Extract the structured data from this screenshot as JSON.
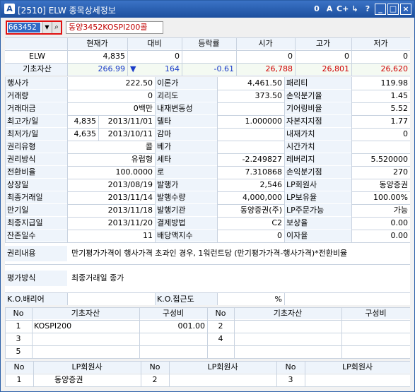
{
  "window": {
    "title": "[2510] ELW 종목상세정보",
    "app_letter": "A",
    "buttons": [
      "0",
      "A",
      "C+",
      "↳",
      "?",
      "_",
      "□",
      "×"
    ]
  },
  "search": {
    "code": "663452",
    "name": "동양3452KOSPI200콜"
  },
  "price_table": {
    "headers": [
      "현재가",
      "대비",
      "등락률",
      "시가",
      "고가",
      "저가"
    ],
    "rows": [
      {
        "label": "ELW",
        "values": [
          "4,835",
          "0",
          "",
          "0",
          "0",
          "0"
        ]
      },
      {
        "label": "기초자산",
        "values": [
          "266.99",
          "164",
          "-0.61",
          "26,788",
          "26,801",
          "26,620"
        ],
        "arrow": "▼"
      }
    ]
  },
  "details": [
    [
      "행사가",
      "222.50",
      "이론가",
      "4,461.50",
      "패리티",
      "119.98"
    ],
    [
      "거래량",
      "0",
      "괴리도",
      "373.50",
      "손익분기율",
      "1.45"
    ],
    [
      "거래대금",
      "0백만",
      "내재변동성",
      "",
      "기어링비율",
      "5.52"
    ],
    [
      "최고가/일",
      "4,835|2013/11/01",
      "델타",
      "1.000000",
      "자본지지점",
      "1.77"
    ],
    [
      "최저가/일",
      "4,635|2013/10/11",
      "감마",
      "",
      "내재가치",
      "0"
    ],
    [
      "권리유형",
      "콜",
      "베가",
      "",
      "시간가치",
      ""
    ],
    [
      "권리방식",
      "유럽형",
      "세타",
      "-2.249827",
      "레버리지",
      "5.520000"
    ],
    [
      "전환비율",
      "100.0000",
      "로",
      "7.310868",
      "손익분기점",
      "270"
    ],
    [
      "상장일",
      "2013/08/19",
      "발행가",
      "2,546",
      "LP회원사",
      "동양증권"
    ],
    [
      "최종거래일",
      "2013/11/14",
      "발행수량",
      "4,000,000",
      "LP보유율",
      "100.00%"
    ],
    [
      "만기일",
      "2013/11/18",
      "발행기관",
      "동양증권(주)",
      "LP주문가능",
      "가능"
    ],
    [
      "최종지급일",
      "2013/11/20",
      "결제방법",
      "C2",
      "보상율",
      "0.00"
    ],
    [
      "잔존일수",
      "11",
      "배당액지수",
      "0",
      "이자율",
      "0.00"
    ]
  ],
  "rights": {
    "label": "권리내용",
    "text": "만기평가가격이 행사가격 초과인 경우, 1워런트당 (만기평가가격-행사가격)*전환비율"
  },
  "valuation": {
    "label": "평가방식",
    "text": "최종거래일 종가"
  },
  "ko": {
    "barrier_label": "K.O.배리어",
    "barrier_value": "",
    "approach_label": "K.O.접근도",
    "approach_value": "%"
  },
  "components": {
    "headers": [
      "No",
      "기초자산",
      "구성비",
      "No",
      "기초자산",
      "구성비"
    ],
    "rows": [
      {
        "no1": "1",
        "asset1": "KOSPI200",
        "ratio1": "001.00",
        "no2": "2",
        "asset2": "",
        "ratio2": ""
      },
      {
        "no1": "3",
        "asset1": "",
        "ratio1": "",
        "no2": "4",
        "asset2": "",
        "ratio2": ""
      },
      {
        "no1": "5",
        "asset1": "",
        "ratio1": "",
        "no2": "",
        "asset2": "",
        "ratio2": ""
      }
    ]
  },
  "lp": {
    "headers": [
      "No",
      "LP회원사",
      "No",
      "LP회원사",
      "No",
      "LP회원사"
    ],
    "row": [
      "1",
      "동양증권",
      "2",
      "",
      "3",
      ""
    ]
  },
  "colors": {
    "title_bar": "#1c4f9e",
    "label_bg": "#eef4fb",
    "up": "#d00000",
    "down": "#1a3cc8",
    "highlight": "#316ac5"
  }
}
